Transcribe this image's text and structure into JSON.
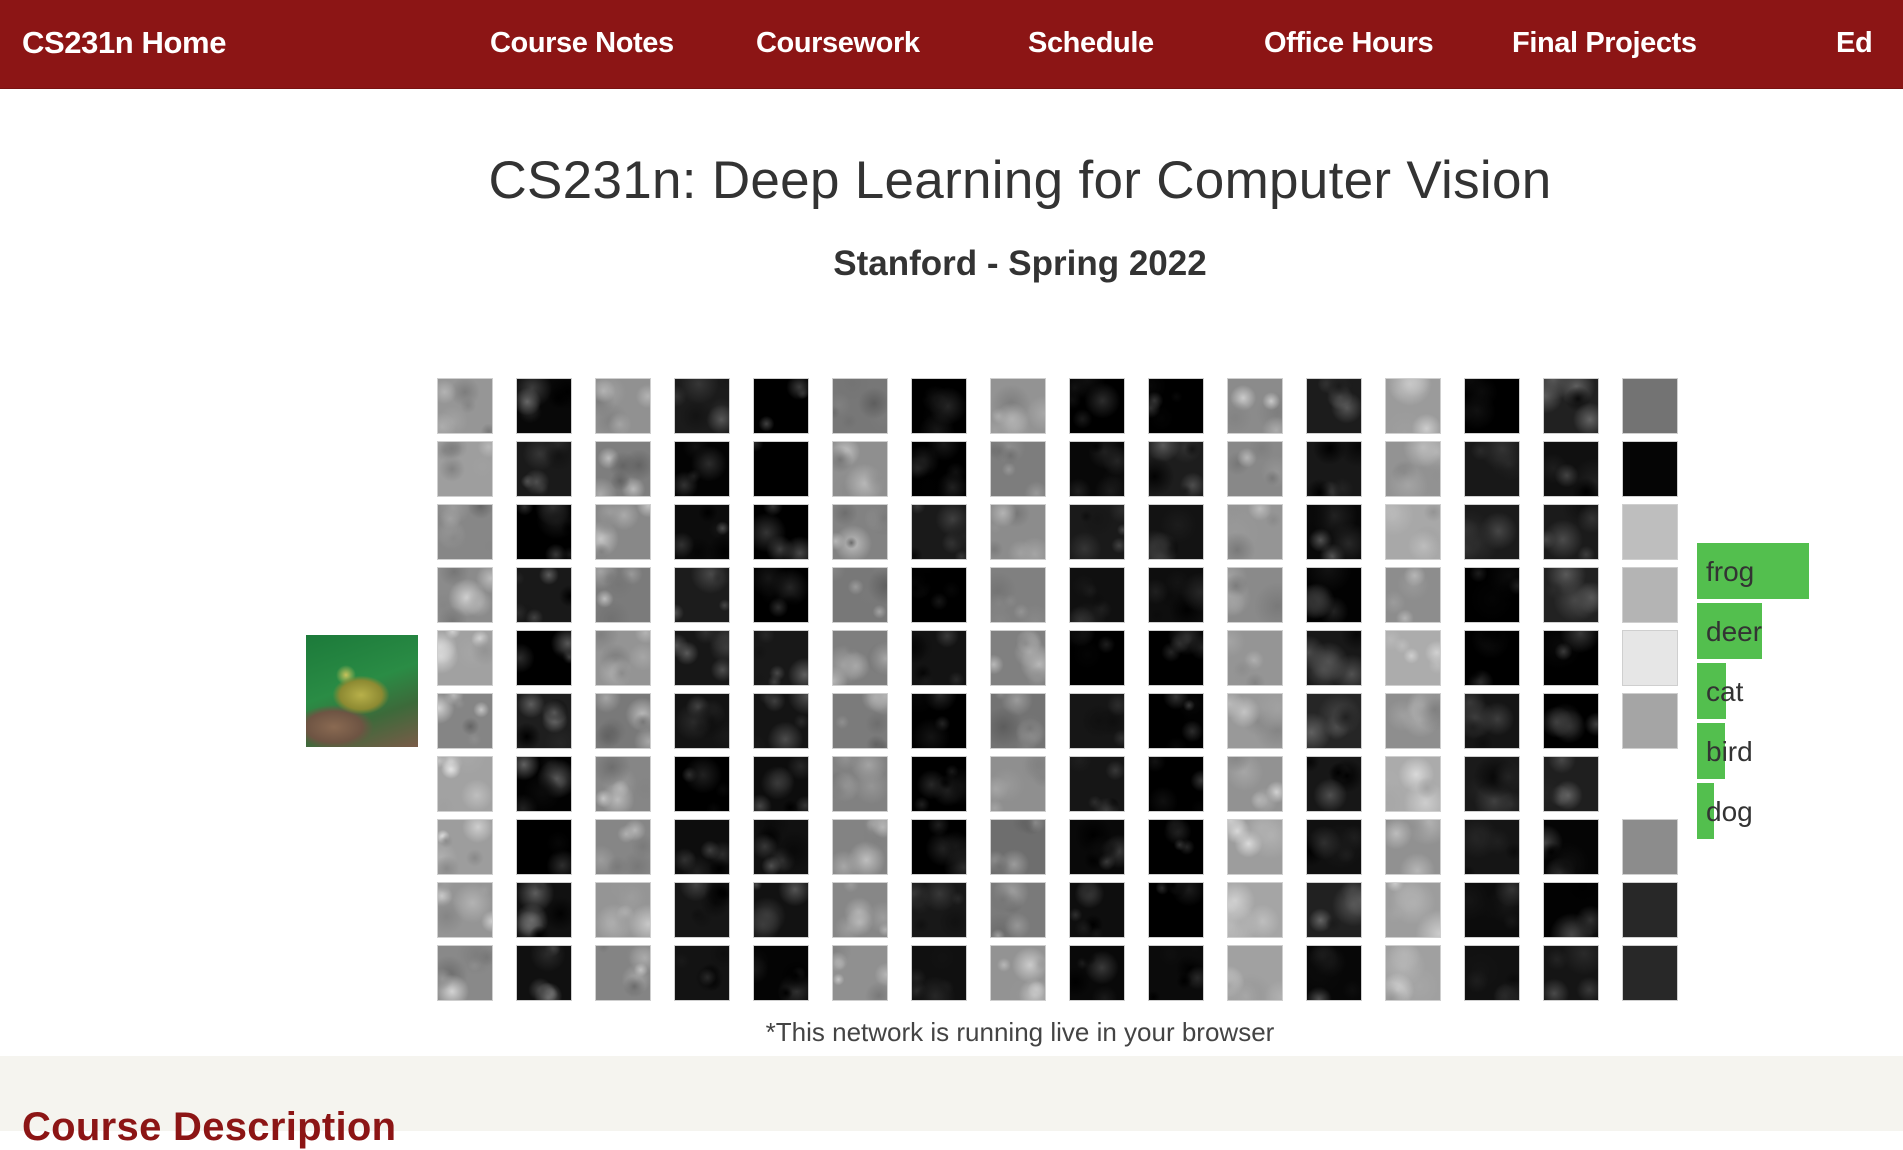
{
  "nav": {
    "brand": "CS231n Home",
    "links": [
      "Course Notes",
      "Coursework",
      "Schedule",
      "Office Hours",
      "Final Projects",
      "Ed"
    ]
  },
  "header": {
    "title": "CS231n: Deep Learning for Computer Vision",
    "subtitle": "Stanford - Spring 2022"
  },
  "demo": {
    "caption": "*This network is running live in your browser",
    "scores": [
      {
        "label": "frog",
        "score": 0.93
      },
      {
        "label": "deer",
        "score": 0.54
      },
      {
        "label": "cat",
        "score": 0.24
      },
      {
        "label": "bird",
        "score": 0.23
      },
      {
        "label": "dog",
        "score": 0.14
      }
    ]
  },
  "section": {
    "heading": "Course Description"
  }
}
